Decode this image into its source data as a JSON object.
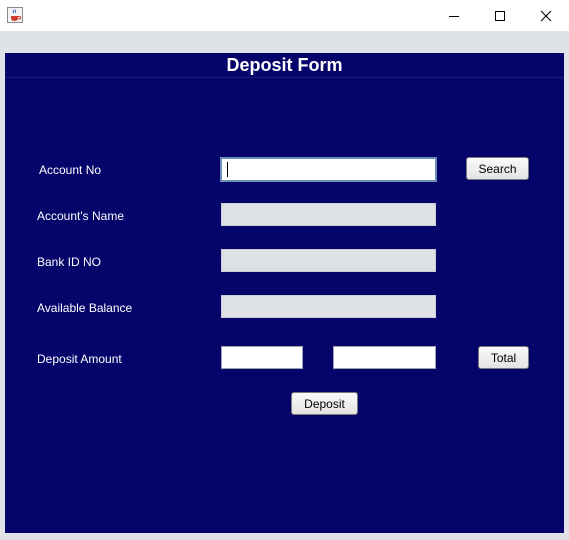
{
  "titlebar": {
    "app_icon": "java-coffee-icon",
    "minimize_icon": "minimize-icon",
    "maximize_icon": "maximize-icon",
    "close_icon": "close-icon"
  },
  "form": {
    "title": "Deposit Form",
    "account_no": {
      "label": "Account No",
      "value": ""
    },
    "search_label": "Search",
    "account_name": {
      "label": "Account's Name",
      "value": ""
    },
    "bank_id": {
      "label": "Bank ID NO",
      "value": ""
    },
    "available_balance": {
      "label": "Available Balance",
      "value": ""
    },
    "deposit_amount": {
      "label": "Deposit Amount",
      "value": "",
      "total_value": ""
    },
    "total_label": "Total",
    "deposit_label": "Deposit"
  },
  "colors": {
    "panel_background": "#04046b",
    "frame_background": "#dfe3e8",
    "readonly_field": "#dde1e5"
  }
}
